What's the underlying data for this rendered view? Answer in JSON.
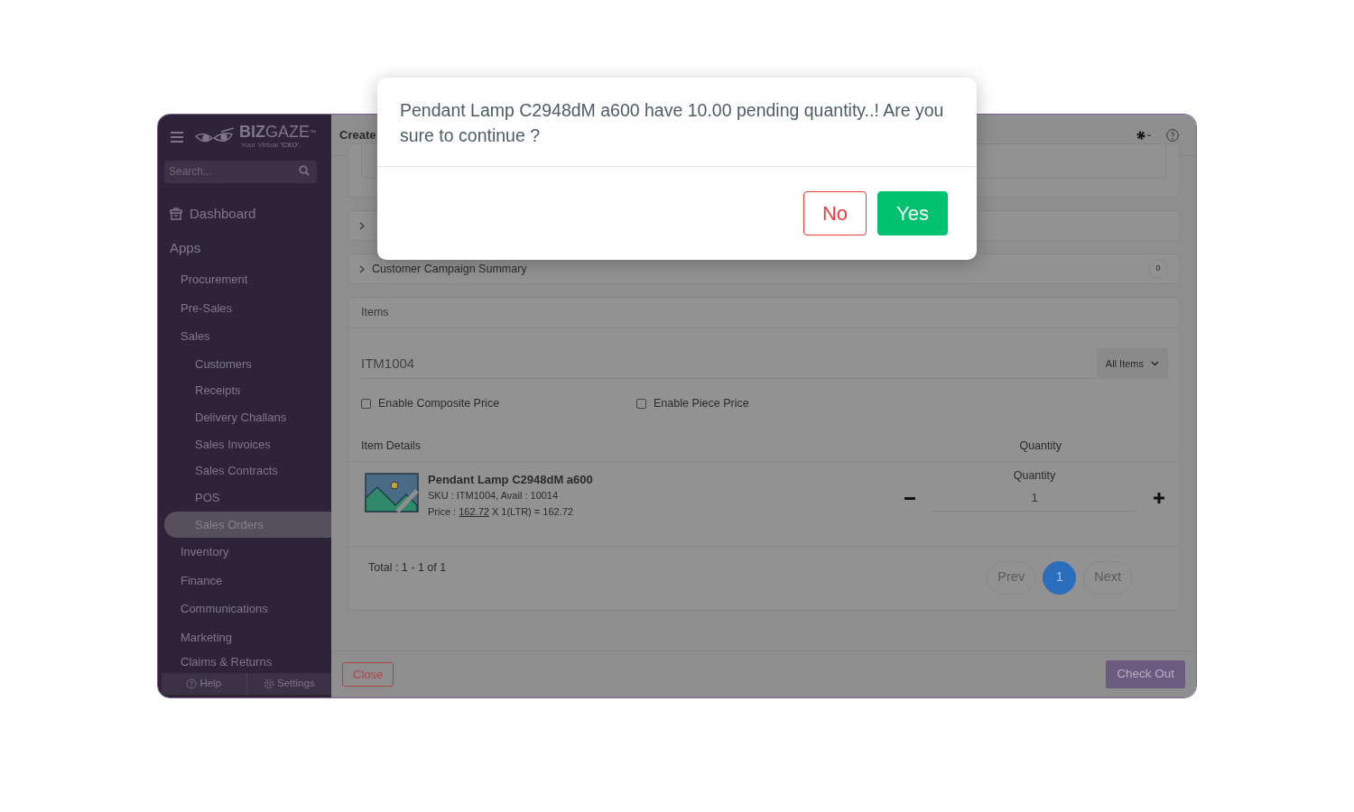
{
  "sidebar": {
    "logo": {
      "brand_bold": "BIZ",
      "brand_light": "GAZE",
      "trademark": "™",
      "tagline": "Your Virtual **'CXO'**."
    },
    "search": {
      "placeholder": "Search..."
    },
    "dashboard": "Dashboard",
    "section": "Apps",
    "items": [
      {
        "label": "Procurement",
        "selected": false
      },
      {
        "label": "Pre-Sales",
        "selected": false
      },
      {
        "label": "Sales",
        "selected": false,
        "children": [
          {
            "label": "Customers",
            "selected": false
          },
          {
            "label": "Receipts",
            "selected": false
          },
          {
            "label": "Delivery Challans",
            "selected": false
          },
          {
            "label": "Sales Invoices",
            "selected": false
          },
          {
            "label": "Sales Contracts",
            "selected": false
          },
          {
            "label": "POS",
            "selected": false
          },
          {
            "label": "Sales Orders",
            "selected": true
          }
        ]
      },
      {
        "label": "Inventory",
        "selected": false
      },
      {
        "label": "Finance",
        "selected": false
      },
      {
        "label": "Communications",
        "selected": false
      },
      {
        "label": "Marketing",
        "selected": false
      },
      {
        "label": "Claims & Returns",
        "selected": false
      }
    ],
    "footer": [
      "Help",
      "Settings"
    ]
  },
  "header": {
    "title": "Create"
  },
  "accordions": [
    {
      "title": "Customer Campaign Summary",
      "badge": "0"
    }
  ],
  "items_panel": {
    "title": "Items",
    "search_value": "ITM1004",
    "filter": "All Items",
    "checkboxes": [
      {
        "label": "Enable Composite Price",
        "checked": false
      },
      {
        "label": "Enable Piece Price",
        "checked": false
      }
    ],
    "columns": [
      "Item Details",
      "Quantity"
    ],
    "rows": [
      {
        "name": "Pendant Lamp C2948dM a600",
        "sku": "SKU : ITM1004, Avail : 10014",
        "price_label": "Price :",
        "price": "162.72",
        "price_rest": "X 1(LTR) = 162.72",
        "quantity_label": "Quantity",
        "quantity": "1"
      }
    ],
    "total": "Total : 1 - 1 of 1",
    "pagination": {
      "prev": "Prev",
      "pages": [
        {
          "label": "1",
          "selected": true
        }
      ],
      "next": "Next"
    }
  },
  "footer": {
    "close": "Close",
    "checkout": "Check Out"
  },
  "modal": {
    "message": "Pendant Lamp C2948dM a600 have 10.00 pending quantity..! Are you sure to continue ?",
    "buttons": [
      {
        "label": "No",
        "kind": "cancel"
      },
      {
        "label": "Yes",
        "kind": "confirm"
      }
    ]
  }
}
